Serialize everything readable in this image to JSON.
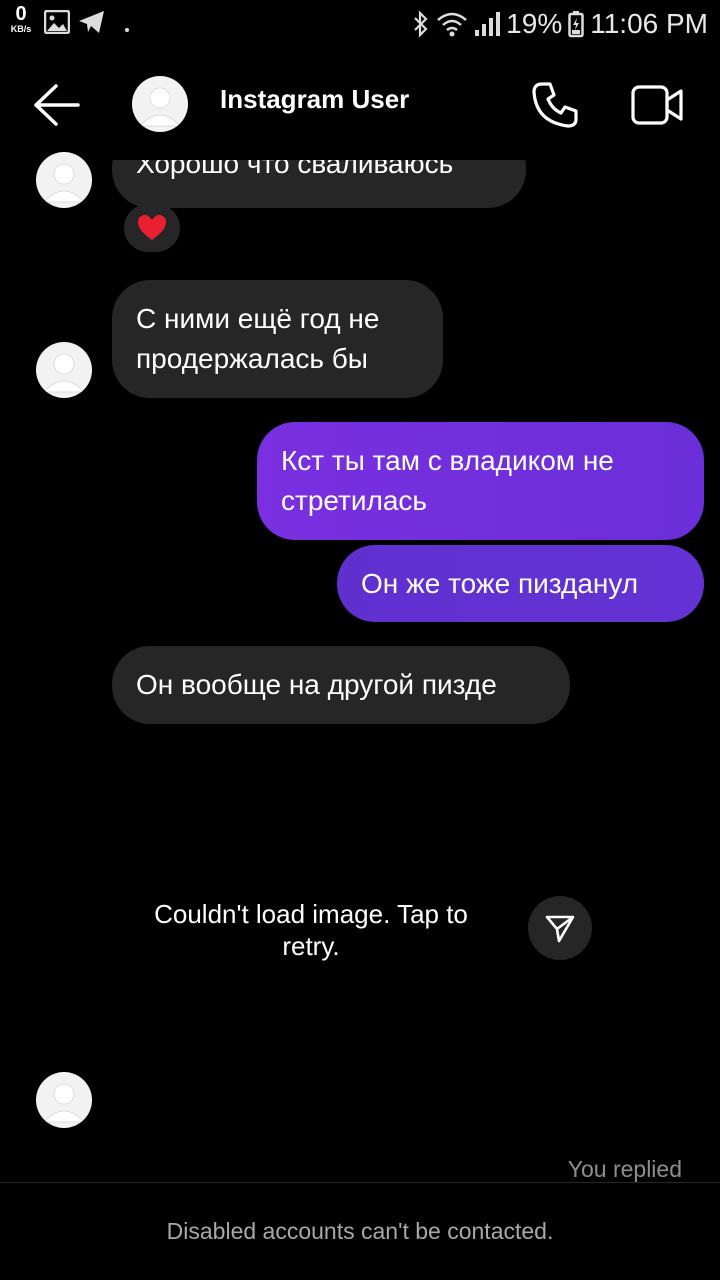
{
  "status_bar": {
    "net_speed": "0",
    "net_unit": "KB/s",
    "battery": "19%",
    "time": "11:06 PM"
  },
  "header": {
    "title": "Instagram User"
  },
  "messages": [
    {
      "from": "them",
      "text": "Хорошо что сваливаюсь",
      "reaction": "heart"
    },
    {
      "from": "them",
      "text": "С ними ещё год не продержалась бы"
    },
    {
      "from": "me",
      "text": "Кст ты там с владиком не стретилась"
    },
    {
      "from": "me",
      "text": "Он же тоже пизданул"
    },
    {
      "from": "them",
      "text": "Он вообще на другой пизде"
    }
  ],
  "image_error": "Couldn't load image. Tap to retry.",
  "you_replied": "You replied",
  "footer": "Disabled accounts can't be contacted.",
  "colors": {
    "background": "#000000",
    "incoming_bubble": "#262626",
    "outgoing_bubble": "#7a2fe0",
    "muted_text": "#8e8e8e"
  }
}
